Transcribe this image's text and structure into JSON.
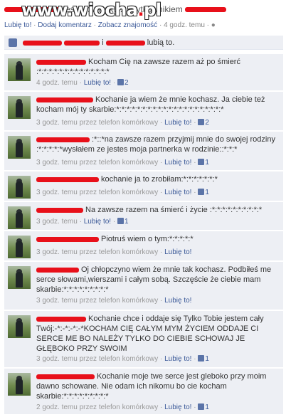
{
  "watermark": {
    "brand": "www.wiocha",
    "dot": ".",
    "tld": "pl"
  },
  "header": {
    "status_text": "jest w związku z użytkownikiem",
    "like_label": "Lubię to!",
    "comment_label": "Dodaj komentarz",
    "friendship_label": "Zobacz znajomość",
    "time": "4 godz. temu",
    "separator": "·"
  },
  "likes_bar": {
    "and": "i",
    "suffix": "lubią to."
  },
  "colors": {
    "redaction": "#e8101a",
    "link": "#3b5998",
    "comment_bg": "#edeff4"
  },
  "comments": [
    {
      "text": "Kocham Cię na zawsze razem aż po śmierć :*:*:*:*:*:*:*:*:*:*:*:*:*:*",
      "time": "4 godz. temu",
      "via": "",
      "like": "Lubię to!",
      "likes": "2"
    },
    {
      "text": "Kochanie ja wiem że mnie kochasz. Ja ciebie też kocham mój ty skarbie:*:*:*:*:*:*:*:*:*:*:*:*:*:*:*:*:*:*:*:*:*",
      "time": "3 godz. temu",
      "via": "przez telefon komórkowy",
      "like": "Lubię to!",
      "likes": "2"
    },
    {
      "text": ":*::*na zawsze razem przyjmij mnie do swojej rodziny :*:*:*:*:*wysłałem ze jestes moja partnerka w rodzinie::*:*:*",
      "time": "3 godz. temu",
      "via": "przez telefon komórkowy",
      "like": "Lubię to!",
      "likes": "1"
    },
    {
      "text": "kochanie ja to zrobiłam:*:*:*:*:*:*:*",
      "time": "3 godz. temu",
      "via": "przez telefon komórkowy",
      "like": "Lubię to!",
      "likes": "1"
    },
    {
      "text": "Na zawsze razem na śmierć i życie :*:*:*:*:*:*:*:*:*:*",
      "time": "3 godz. temu",
      "via": "",
      "like": "Lubię to!",
      "likes": "1"
    },
    {
      "text": "Piotruś wiem o tym:*:*:*:*:*",
      "time": "3 godz. temu",
      "via": "przez telefon komórkowy",
      "like": "Lubię to!",
      "likes": ""
    },
    {
      "text": "Oj chłopczyno wiem że mnie tak kochasz. Podbiłeś me serce słowami,wierszami i całym sobą. Szczęście że ciebie mam skarbie:*:*:*:*:*:*:*:*:*",
      "time": "3 godz. temu",
      "via": "przez telefon komórkowy",
      "like": "Lubię to!",
      "likes": ""
    },
    {
      "text": "Kochanie chce i oddaje się Tylko Tobie jestem cały Twój:-*:-*:-*:-*KOCHAM CIĘ CAŁYM MYM ŻYCIEM ODDAJE CI SERCE ME BO NALEŻY TYLKO DO CIEBIE SCHOWAJ JE GŁĘBOKO PRZY SWOIM",
      "time": "3 godz. temu",
      "via": "przez telefon komórkowy",
      "like": "Lubię to!",
      "likes": "1"
    },
    {
      "text": "Kochanie moje twe serce jest gleboko przy moim dawno schowane. Nie odam ich nikomu bo cie kocham skarbie:*:*:*:*:*:*:*:*:*",
      "time": "2 godz. temu",
      "via": "przez telefon komórkowy",
      "like": "Lubię to!",
      "likes": "1"
    }
  ]
}
